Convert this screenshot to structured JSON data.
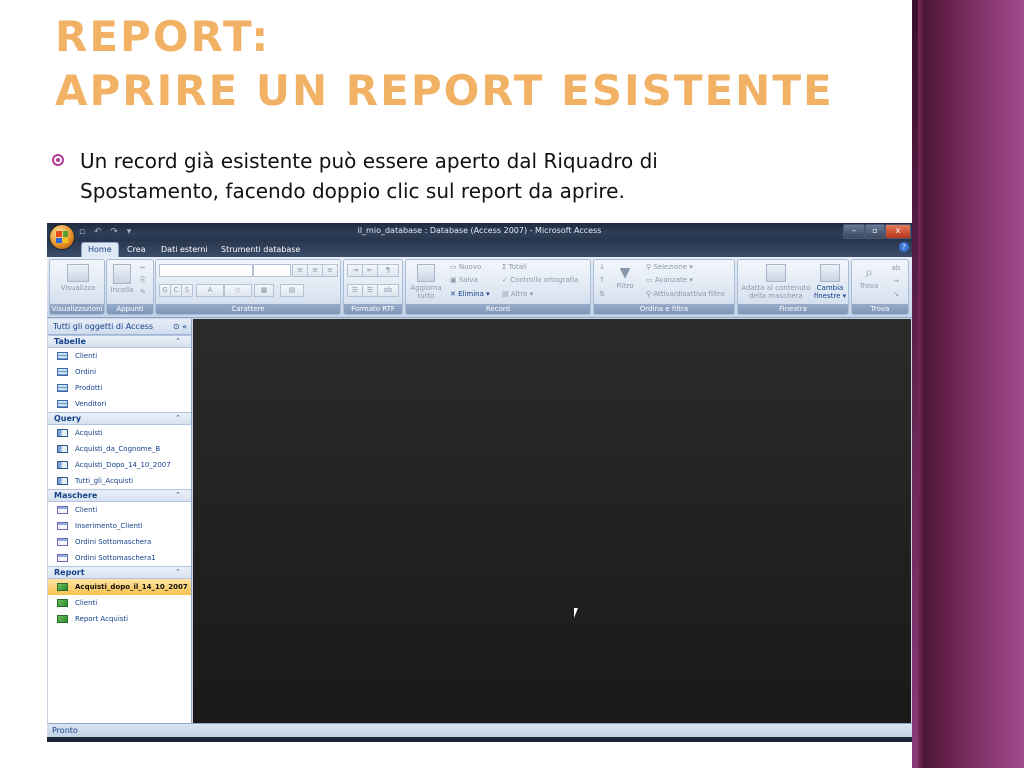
{
  "slide": {
    "title_line1": "REPORT:",
    "title_line2": "APRIRE UN REPORT ESISTENTE",
    "bullet_line1": "Un record già esistente può essere aperto dal Riquadro di",
    "bullet_line2": "Spostamento, facendo doppio clic sul report da aprire.",
    "accent_color": "#f2b266",
    "bullet_color": "#b03a94"
  },
  "window": {
    "title": "il_mio_database : Database (Access 2007) - Microsoft Access",
    "tabs": [
      "Home",
      "Crea",
      "Dati esterni",
      "Strumenti database"
    ],
    "active_tab": "Home"
  },
  "ribbon": {
    "groups": {
      "visualizzazioni": "Visualizzazioni",
      "appunti": "Appunti",
      "carattere": "Carattere",
      "formato_rtf": "Formato RTF",
      "record": "Record",
      "ordina_filtra": "Ordina e filtra",
      "finestra": "Finestra",
      "trova": "Trova"
    },
    "buttons": {
      "visualizza": "Visualizza",
      "incolla": "Incolla",
      "aggiorna": "Aggiorna",
      "tutto": "tutto",
      "nuovo": "Nuovo",
      "salva": "Salva",
      "elimina": "Elimina",
      "totali": "Totali",
      "controllo": "Controllo ortografia",
      "altro": "Altro",
      "filtro": "Filtro",
      "selezione": "Selezione",
      "avanzate": "Avanzate",
      "attiva_filtro": "Attiva/disattiva filtro",
      "adatta": "Adatta al contenuto",
      "della_maschera": "della maschera",
      "cambia": "Cambia",
      "finestre": "finestre",
      "trova": "Trova"
    }
  },
  "nav": {
    "header": "Tutti gli oggetti di Access",
    "categories": [
      {
        "name": "Tabelle",
        "items": [
          "Clienti",
          "Ordini",
          "Prodotti",
          "Venditori"
        ]
      },
      {
        "name": "Query",
        "items": [
          "Acquisti",
          "Acquisti_da_Cognome_B",
          "Acquisti_Dopo_14_10_2007",
          "Tutti_gli_Acquisti"
        ]
      },
      {
        "name": "Maschere",
        "items": [
          "Clienti",
          "Inserimento_Clienti",
          "Ordini Sottomaschera",
          "Ordini Sottomaschera1"
        ]
      },
      {
        "name": "Report",
        "items": [
          "Acquisti_dopo_il_14_10_2007",
          "Clienti",
          "Report Acquisti"
        ]
      }
    ],
    "selected": "Acquisti_dopo_il_14_10_2007"
  },
  "status": {
    "text": "Pronto"
  }
}
